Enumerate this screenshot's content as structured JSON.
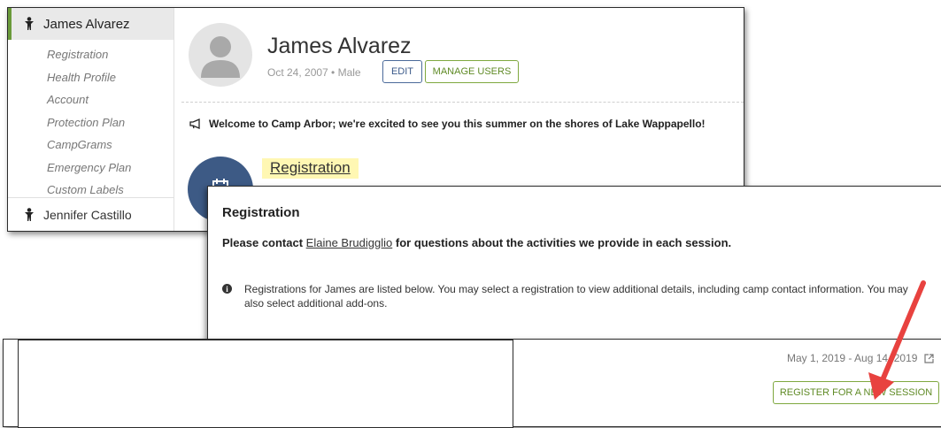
{
  "sidebar": {
    "active_child": "James Alvarez",
    "items": [
      {
        "label": "Registration"
      },
      {
        "label": "Health Profile"
      },
      {
        "label": "Account"
      },
      {
        "label": "Protection Plan"
      },
      {
        "label": "CampGrams"
      },
      {
        "label": "Emergency Plan"
      },
      {
        "label": "Custom Labels"
      }
    ],
    "other_child": "Jennifer Castillo"
  },
  "profile": {
    "name": "James Alvarez",
    "meta": "Oct 24, 2007 • Male",
    "edit_label": "EDIT",
    "manage_label": "MANAGE USERS"
  },
  "welcome_message": "Welcome to Camp Arbor; we're excited to see you this summer on the shores of Lake Wappapello!",
  "registration_link": "Registration",
  "registration_panel": {
    "title": "Registration",
    "contact_prefix": "Please contact",
    "contact_name": "Elaine Brudigglio",
    "contact_suffix": "for questions about the activities we provide in each session.",
    "info": "Registrations for James are listed below. You may select a registration to view additional details, including camp contact information. You may also select additional add-ons."
  },
  "session": {
    "dates": "May 1, 2019 - Aug 14, 2019",
    "register_label": "REGISTER FOR A NEW SESSION"
  },
  "colors": {
    "accent_green": "#7fa83f",
    "accent_blue": "#3d5a85",
    "highlight": "#fff7b3",
    "annotation_arrow": "#e8423f"
  }
}
